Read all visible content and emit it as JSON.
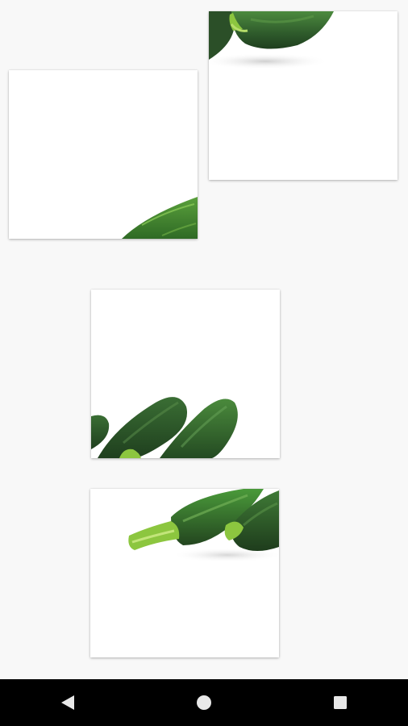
{
  "puzzle": {
    "pieces": [
      {
        "id": "piece-1",
        "subject": "zucchini-top-edge"
      },
      {
        "id": "piece-2",
        "subject": "zucchini-bottom-right-corner"
      },
      {
        "id": "piece-3",
        "subject": "zucchini-pair-bottom-left"
      },
      {
        "id": "piece-4",
        "subject": "zucchini-stems-top"
      }
    ]
  },
  "nav_bar": {
    "back_icon": "triangle-back-icon",
    "home_icon": "circle-home-icon",
    "recents_icon": "square-recents-icon"
  },
  "colors": {
    "background": "#f8f8f8",
    "tile": "#ffffff",
    "zucchini_dark": "#2f5a2c",
    "zucchini_light": "#3f7a34",
    "stem": "#8cc63f",
    "nav_bar": "#000000"
  }
}
